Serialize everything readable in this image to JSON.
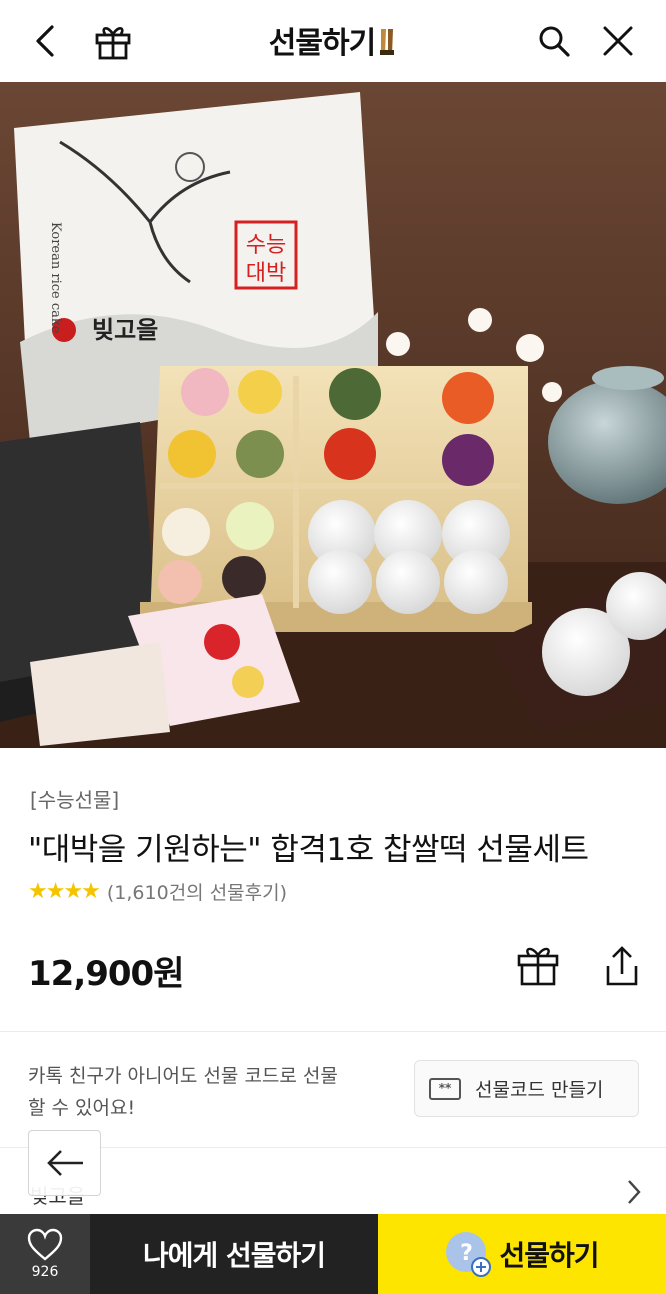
{
  "header": {
    "title": "선물하기",
    "icons": [
      "back-icon",
      "gift-box-icon",
      "search-icon",
      "close-icon"
    ]
  },
  "hero": {
    "image_alt": "수능대박 찹쌀떡 선물세트 product photo",
    "box_stamp": "수능대박",
    "box_brand": "빚고을",
    "box_side_text": "Korean rice cake"
  },
  "product": {
    "category": "[수능선물]",
    "name": "\"대박을 기원하는\" 합격1호 찹쌀떡 선물세트",
    "stars": "★★★★",
    "rating_value": 4,
    "reviews": "(1,610건의 선물후기)",
    "price": "12,900원"
  },
  "giftcode": {
    "description": "카톡 친구가 아니어도 선물 코드로 선물 할 수 있어요!",
    "icon_text": "**",
    "button_label": "선물코드 만들기"
  },
  "shop": {
    "name": "빚고을"
  },
  "bottom_bar": {
    "like_count": "926",
    "self_gift_label": "나에게 선물하기",
    "gift_label": "선물하기",
    "gift_icon_text": "?"
  },
  "colors": {
    "accent_yellow": "#fee500",
    "star_yellow": "#f5c400",
    "dark_button": "#222222"
  }
}
